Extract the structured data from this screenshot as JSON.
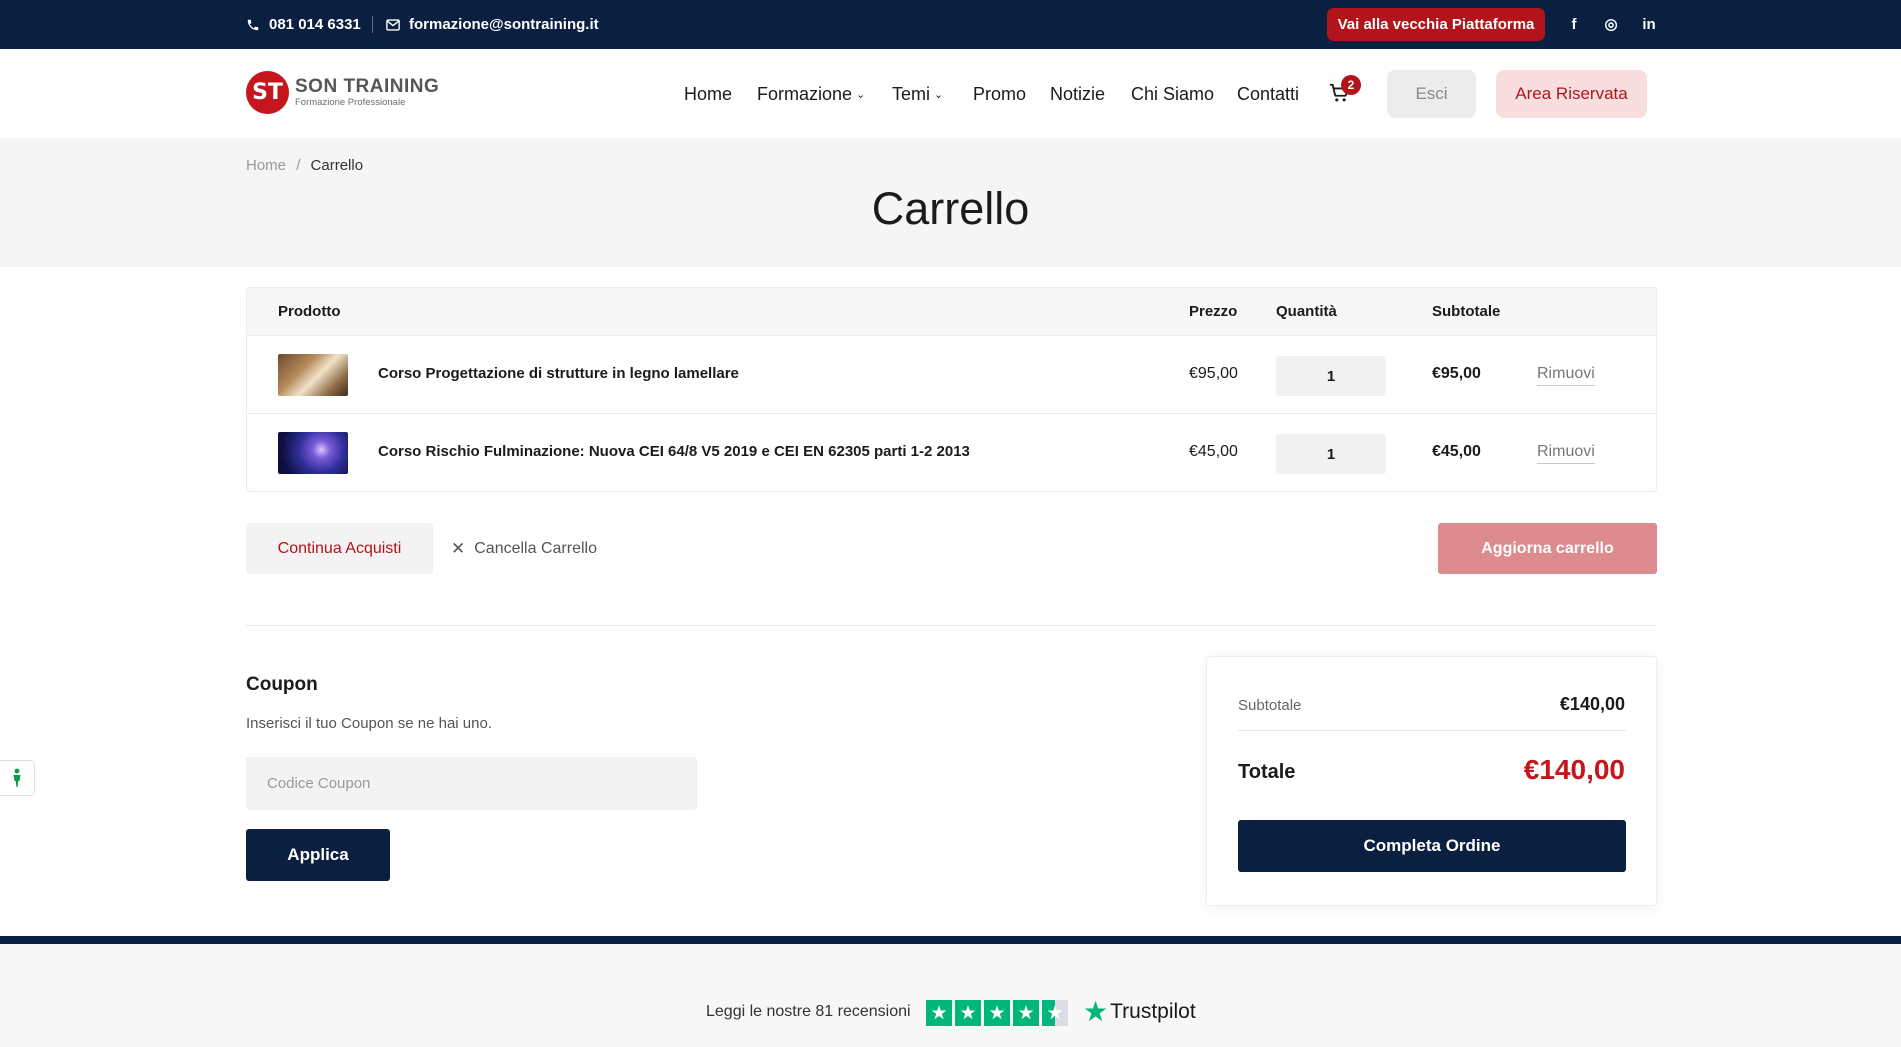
{
  "topbar": {
    "phone": "081 014 6331",
    "email": "formazione@sontraining.it",
    "old_platform_label": "Vai alla vecchia Piattaforma",
    "social": [
      {
        "icon": "facebook-icon",
        "glyph": "f"
      },
      {
        "icon": "instagram-icon",
        "glyph": "◎"
      },
      {
        "icon": "linkedin-icon",
        "glyph": "in"
      }
    ]
  },
  "header": {
    "logo_mark": "ST",
    "brand": "SON TRAINING",
    "brand_sub": "Formazione Professionale",
    "nav": [
      "Home",
      "Formazione",
      "Temi",
      "Promo",
      "Notizie",
      "Chi Siamo",
      "Contatti"
    ],
    "cart_count": "2",
    "logout_label": "Esci",
    "reserved_area_label": "Area Riservata"
  },
  "breadcrumb": {
    "home": "Home",
    "separator": "/",
    "current": "Carrello"
  },
  "page_title": "Carrello",
  "cart": {
    "headers": {
      "product": "Prodotto",
      "price": "Prezzo",
      "quantity": "Quantità",
      "subtotal": "Subtotale"
    },
    "items": [
      {
        "name": "Corso Progettazione di strutture in legno lamellare",
        "price": "€95,00",
        "quantity": "1",
        "subtotal": "€95,00",
        "remove_label": "Rimuovi"
      },
      {
        "name": "Corso Rischio Fulminazione: Nuova CEI 64/8 V5 2019 e CEI EN 62305 parti 1-2 2013",
        "price": "€45,00",
        "quantity": "1",
        "subtotal": "€45,00",
        "remove_label": "Rimuovi"
      }
    ],
    "continue_label": "Continua Acquisti",
    "clear_label": "Cancella Carrello",
    "update_label": "Aggiorna carrello"
  },
  "coupon": {
    "title": "Coupon",
    "description": "Inserisci il tuo Coupon se ne hai uno.",
    "placeholder": "Codice Coupon",
    "apply_label": "Applica"
  },
  "totals": {
    "subtotal_label": "Subtotale",
    "subtotal_value": "€140,00",
    "total_label": "Totale",
    "total_value": "€140,00",
    "checkout_label": "Completa Ordine"
  },
  "footer": {
    "reviews_text": "Leggi le nostre 81 recensioni",
    "trustpilot_label": "Trustpilot"
  },
  "colors": {
    "navy": "#0b1f41",
    "brand_red": "#b3141c",
    "trustpilot_green": "#00b67a"
  }
}
